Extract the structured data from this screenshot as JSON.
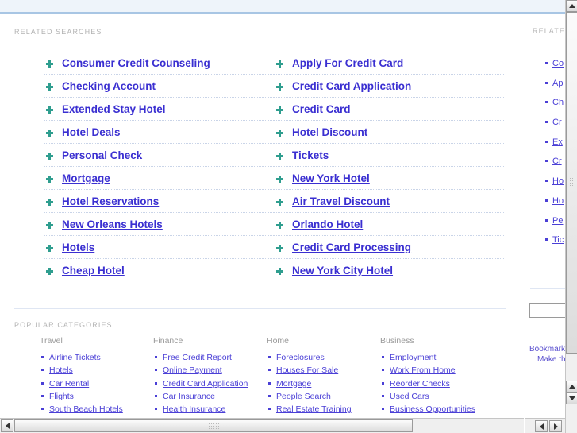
{
  "page": {
    "background_color": "#ffffff",
    "link_color": "#3a2fd1",
    "label_color": "#b3b3b3",
    "accent_color": "#2f9e8f"
  },
  "main": {
    "related_searches": {
      "label": "RELATED SEARCHES",
      "bullet_icon": "arrow-plus-icon",
      "columns": [
        {
          "items": [
            "Consumer Credit Counseling",
            "Checking Account",
            "Extended Stay Hotel",
            "Hotel Deals",
            "Personal Check",
            "Mortgage",
            "Hotel Reservations",
            "New Orleans Hotels",
            "Hotels",
            "Cheap Hotel"
          ]
        },
        {
          "items": [
            "Apply For Credit Card",
            "Credit Card Application",
            "Credit Card",
            "Hotel Discount",
            "Tickets",
            "New York Hotel",
            "Air Travel Discount",
            "Orlando Hotel",
            "Credit Card Processing",
            "New York City Hotel"
          ]
        }
      ]
    },
    "popular_categories": {
      "label": "POPULAR CATEGORIES",
      "bullet_icon": "dot-bullet-icon",
      "columns": [
        {
          "heading": "Travel",
          "items": [
            "Airline Tickets",
            "Hotels",
            "Car Rental",
            "Flights",
            "South Beach Hotels"
          ]
        },
        {
          "heading": "Finance",
          "items": [
            "Free Credit Report",
            "Online Payment",
            "Credit Card Application",
            "Car Insurance",
            "Health Insurance"
          ]
        },
        {
          "heading": "Home",
          "items": [
            "Foreclosures",
            "Houses For Sale",
            "Mortgage",
            "People Search",
            "Real Estate Training"
          ]
        },
        {
          "heading": "Business",
          "items": [
            "Employment",
            "Work From Home",
            "Reorder Checks",
            "Used Cars",
            "Business Opportunities"
          ]
        }
      ]
    }
  },
  "side_panel": {
    "label": "RELATED",
    "items": [
      "Co",
      "Ap",
      "Ch",
      "Cr",
      "Ex",
      "Cr",
      "Ho",
      "Ho",
      "Pe",
      "Tic"
    ],
    "search_input_value": "",
    "search_input_placeholder": "",
    "footer_line1": "Bookmark",
    "footer_line2": "Make this"
  },
  "scrollbars": {
    "page_vertical": {
      "up_icon": "triangle-up-icon",
      "down_icon": "triangle-down-icon",
      "grip_icon": "grip-icon"
    },
    "main_horizontal": {
      "left_icon": "triangle-left-icon",
      "right_icon": "triangle-right-icon",
      "grip_icon": "grip-icon"
    },
    "side_horizontal": {
      "left_icon": "triangle-left-icon",
      "right_icon": "triangle-right-icon"
    }
  }
}
